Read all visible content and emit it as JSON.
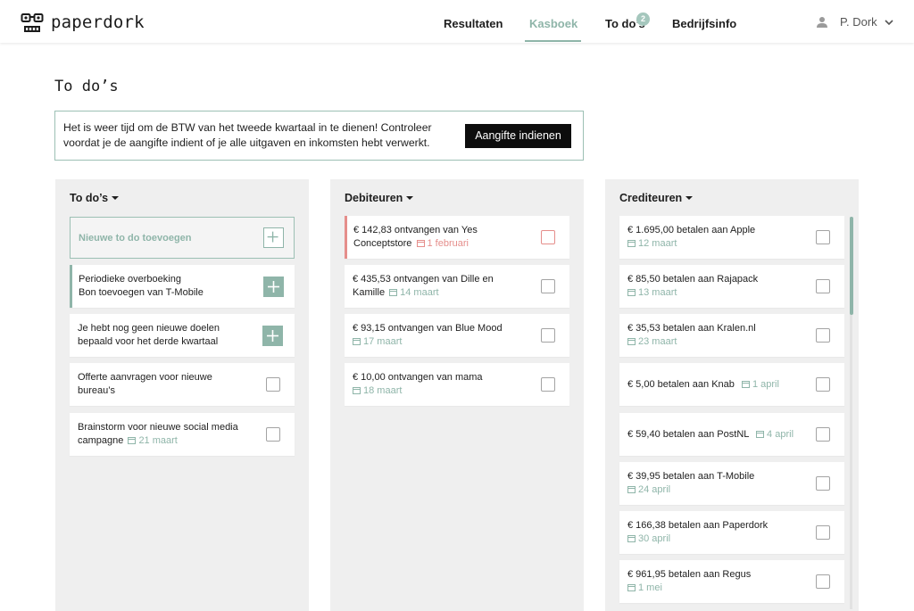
{
  "app": {
    "logo_text": "paperdork"
  },
  "nav": {
    "items": [
      {
        "label": "Resultaten",
        "active": false
      },
      {
        "label": "Kasboek",
        "active": true
      },
      {
        "label": "To do’s",
        "active": false,
        "badge": "2"
      },
      {
        "label": "Bedrijfsinfo",
        "active": false
      }
    ],
    "user_name": "P. Dork"
  },
  "page_title": "To do’s",
  "notice": {
    "text": "Het is weer tijd om de BTW van het tweede kwartaal in te dienen! Controleer voordat je de aangifte indient of je alle uitgaven en inkomsten hebt verwerkt.",
    "button_label": "Aangifte indienen"
  },
  "columns": {
    "todos": {
      "title": "To do’s",
      "new_label": "Nieuwe to do toevoegen",
      "items": [
        {
          "line1": "Periodieke overboeking",
          "line2": "Bon toevoegen van T-Mobile"
        },
        {
          "line1": "Je hebt nog geen nieuwe doelen",
          "line2": "bepaald voor het derde kwartaal"
        },
        {
          "line1": "Offerte aanvragen voor nieuwe",
          "line2": "bureau’s"
        },
        {
          "line1": "Brainstorm voor nieuwe social media",
          "line2": "campagne",
          "date": "21 maart"
        }
      ]
    },
    "debiteuren": {
      "title": "Debiteuren",
      "items": [
        {
          "line1": "€ 142,83 ontvangen van Yes",
          "line2": "Conceptstore",
          "date": "1 februari"
        },
        {
          "line1": "€ 435,53 ontvangen van Dille en",
          "line2": "Kamille",
          "date": "14 maart"
        },
        {
          "line1": "€ 93,15 ontvangen van Blue Mood",
          "date": "17 maart"
        },
        {
          "line1": "€ 10,00 ontvangen van mama",
          "date": "18 maart"
        }
      ]
    },
    "crediteuren": {
      "title": "Crediteuren",
      "items": [
        {
          "line1": "€ 1.695,00 betalen aan Apple",
          "date": "12 maart"
        },
        {
          "line1": "€ 85,50 betalen aan Rajapack",
          "date": "13 maart"
        },
        {
          "line1": "€ 35,53 betalen aan Kralen.nl",
          "date": "23 maart"
        },
        {
          "line1": "€ 5,00 betalen aan Knab",
          "date": "1 april"
        },
        {
          "line1": "€ 59,40 betalen aan PostNL",
          "date": "4 april"
        },
        {
          "line1": "€ 39,95 betalen aan T-Mobile",
          "date": "24 april"
        },
        {
          "line1": "€ 166,38 betalen aan Paperdork",
          "date": "30 april"
        },
        {
          "line1": "€ 961,95 betalen aan Regus",
          "date": "1 mei"
        }
      ]
    }
  },
  "colors": {
    "accent": "#8fb5a9",
    "alert": "#e58e8b",
    "button": "#0d0d0d",
    "column_bg": "#efefef"
  },
  "icons": [
    "logo-glasses-icon",
    "user-icon",
    "chevron-down-icon",
    "caret-down-icon",
    "calendar-icon",
    "plus-icon",
    "checkbox-icon"
  ]
}
